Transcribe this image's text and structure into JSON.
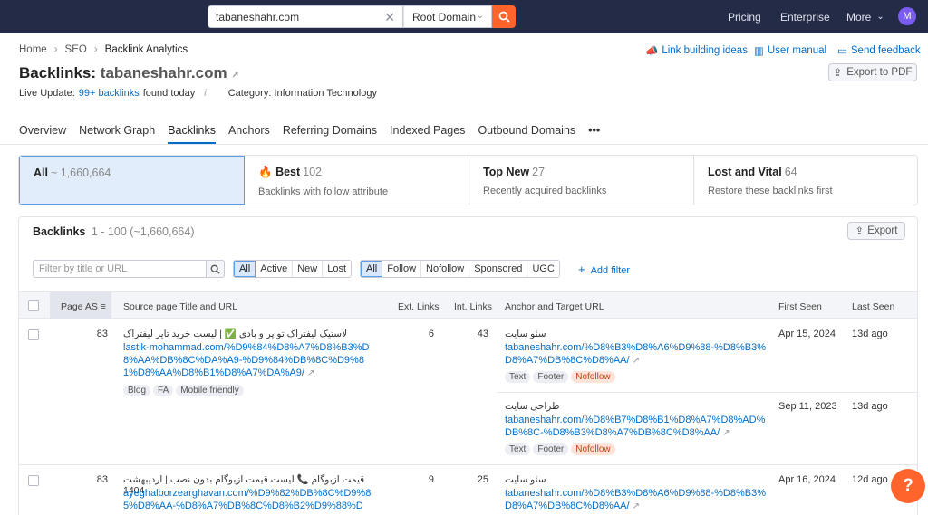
{
  "topbar": {
    "search_value": "tabaneshahr.com",
    "scope": "Root Domain",
    "nav": [
      "Pricing",
      "Enterprise",
      "More"
    ],
    "avatar": "M"
  },
  "breadcrumb": [
    "Home",
    "SEO",
    "Backlink Analytics"
  ],
  "header_links": {
    "ideas": "Link building ideas",
    "manual": "User manual",
    "feedback": "Send feedback",
    "export_pdf": "Export to PDF"
  },
  "title": {
    "label": "Backlinks:",
    "domain": "tabaneshahr.com"
  },
  "live": {
    "prefix": "Live Update:",
    "link": "99+ backlinks",
    "suffix": "found today",
    "info": "i",
    "category": "Category: Information Technology"
  },
  "tabs": [
    "Overview",
    "Network Graph",
    "Backlinks",
    "Anchors",
    "Referring Domains",
    "Indexed Pages",
    "Outbound Domains",
    "•••"
  ],
  "cards": [
    {
      "title": "All",
      "count": "~ 1,660,664",
      "sub": ""
    },
    {
      "title": "Best",
      "count": "102",
      "sub": "Backlinks with follow attribute"
    },
    {
      "title": "Top New",
      "count": "27",
      "sub": "Recently acquired backlinks"
    },
    {
      "title": "Lost and Vital",
      "count": "64",
      "sub": "Restore these backlinks first"
    }
  ],
  "panel": {
    "title": "Backlinks",
    "range": "1 - 100 (~1,660,664)",
    "export": "Export",
    "filter_placeholder": "Filter by title or URL",
    "status_filters": [
      "All",
      "Active",
      "New",
      "Lost"
    ],
    "type_filters": [
      "All",
      "Follow",
      "Nofollow",
      "Sponsored",
      "UGC"
    ],
    "add_filter": "Add filter"
  },
  "columns": [
    "Page AS",
    "Source page Title and URL",
    "Ext. Links",
    "Int. Links",
    "Anchor and Target URL",
    "First Seen",
    "Last Seen"
  ],
  "rows": [
    {
      "page_as": "83",
      "source_title": "لاستیک لیفتراک تو پر و بادی ✅ | لیست خرید تایر لیفتراک",
      "source_url": "lastik-mohammad.com/%D9%84%D8%A7%D8%B3%D8%AA%DB%8C%DA%A9-%D9%84%DB%8C%D9%81%D8%AA%D8%B1%D8%A7%DA%A9/",
      "source_tags": [
        "Blog",
        "FA",
        "Mobile friendly"
      ],
      "ext": "6",
      "int": "43",
      "anchors": [
        {
          "anchor": "سئو سایت",
          "url": "tabaneshahr.com/%D8%B3%D8%A6%D9%88-%D8%B3%D8%A7%DB%8C%D8%AA/",
          "tags": [
            "Text",
            "Footer",
            "Nofollow"
          ],
          "first": "Apr 15, 2024",
          "last": "13d ago"
        },
        {
          "anchor": "طراحی سایت",
          "url": "tabaneshahr.com/%D8%B7%D8%B1%D8%A7%D8%AD%DB%8C-%D8%B3%D8%A7%DB%8C%D8%AA/",
          "tags": [
            "Text",
            "Footer",
            "Nofollow"
          ],
          "first": "Sep 11, 2023",
          "last": "13d ago"
        }
      ]
    },
    {
      "page_as": "83",
      "source_title": "قیمت ازبوگام 📞 لیست قیمت ازبوگام بدون نصب | اردیبهشت 1404",
      "source_url": "ayeghalborzearghavan.com/%D9%82%DB%8C%D9%85%D8%AA-%D8%A7%DB%8C%D8%B2%D9%88%D",
      "ext": "9",
      "int": "25",
      "anchors": [
        {
          "anchor": "سئو سایت",
          "url": "tabaneshahr.com/%D8%B3%D8%A6%D9%88-%D8%B3%D8%A7%DB%8C%D8%AA/",
          "first": "Apr 16, 2024",
          "last": "12d ago"
        }
      ]
    }
  ],
  "help": "?",
  "colors": {
    "accent": "#ff642d",
    "link": "#006dca",
    "topbar": "#242b46"
  }
}
